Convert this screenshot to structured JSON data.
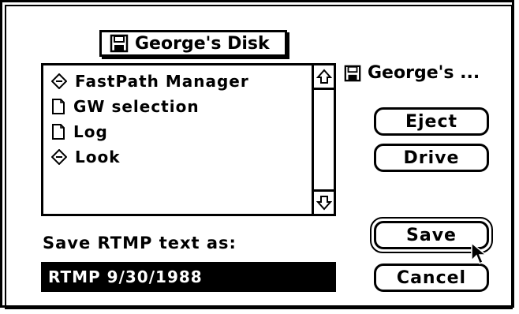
{
  "dialog": {
    "volume_popup": {
      "label": "George's Disk",
      "icon": "floppy-disk-icon"
    },
    "volume_label": {
      "label": "George's ...",
      "icon": "floppy-disk-icon"
    },
    "file_list": {
      "items": [
        {
          "name": "FastPath Manager",
          "icon": "application-icon"
        },
        {
          "name": "GW selection",
          "icon": "document-icon"
        },
        {
          "name": "Log",
          "icon": "document-icon"
        },
        {
          "name": "Look",
          "icon": "application-icon"
        }
      ]
    },
    "buttons": {
      "eject": "Eject",
      "drive": "Drive",
      "save": "Save",
      "cancel": "Cancel"
    },
    "prompt": "Save RTMP text as:",
    "filename": "RTMP 9/30/1988"
  }
}
